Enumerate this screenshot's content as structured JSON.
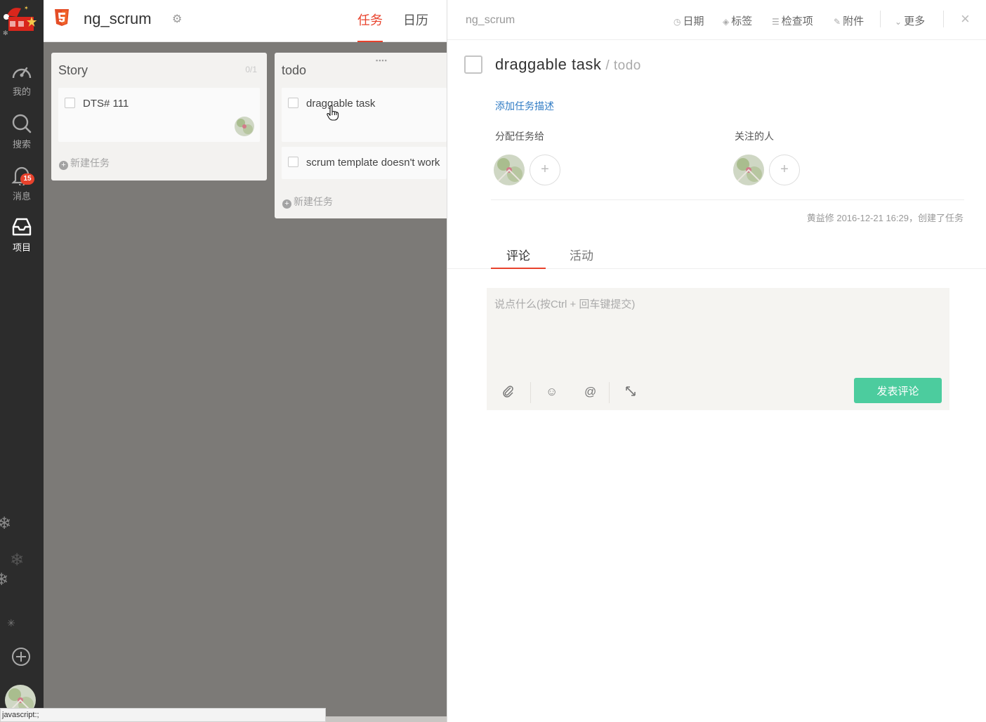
{
  "nav": {
    "items": [
      {
        "name": "mine",
        "label": "我的",
        "icon": "gauge-icon"
      },
      {
        "name": "search",
        "label": "搜索",
        "icon": "search-icon"
      },
      {
        "name": "messages",
        "label": "消息",
        "icon": "bell-icon",
        "badge": "15"
      },
      {
        "name": "projects",
        "label": "项目",
        "icon": "inbox-icon",
        "active": true
      }
    ]
  },
  "topbar": {
    "project_name": "ng_scrum",
    "tabs": [
      {
        "label": "任务",
        "active": true
      },
      {
        "label": "日历",
        "active": false
      }
    ]
  },
  "board": {
    "columns": [
      {
        "title": "Story",
        "count": "0/1",
        "cards": [
          {
            "title": "DTS# 111"
          }
        ],
        "new_task": "新建任务"
      },
      {
        "title": "todo",
        "cards": [
          {
            "title": "draggable task"
          },
          {
            "title": "scrum template doesn't work"
          }
        ],
        "new_task": "新建任务"
      }
    ]
  },
  "status_bar": "javascript:;",
  "panel": {
    "breadcrumb": "ng_scrum",
    "header_actions": [
      {
        "label": "日期",
        "icon": "clock-icon"
      },
      {
        "label": "标签",
        "icon": "tag-icon"
      },
      {
        "label": "检查项",
        "icon": "checklist-icon"
      },
      {
        "label": "附件",
        "icon": "paperclip-icon"
      },
      {
        "label": "更多",
        "icon": "chevron-down-icon"
      }
    ],
    "close_symbol": "×",
    "task_title": "draggable task",
    "task_list": "/ todo",
    "add_description": "添加任务描述",
    "assign_label": "分配任务给",
    "followers_label": "关注的人",
    "created_info": "黄益修 2016-12-21 16:29，创建了任务",
    "tabs": [
      {
        "label": "评论",
        "active": true
      },
      {
        "label": "活动",
        "active": false
      }
    ],
    "comment": {
      "value": "",
      "placeholder": "说点什么(按Ctrl + 回车键提交)",
      "submit_label": "发表评论"
    }
  },
  "colors": {
    "accent_red": "#e8422c",
    "link_blue": "#2f7bc4",
    "submit_green": "#4ccc9e",
    "rail_bg": "#2c2c2c",
    "board_bg": "#7c7a77"
  }
}
